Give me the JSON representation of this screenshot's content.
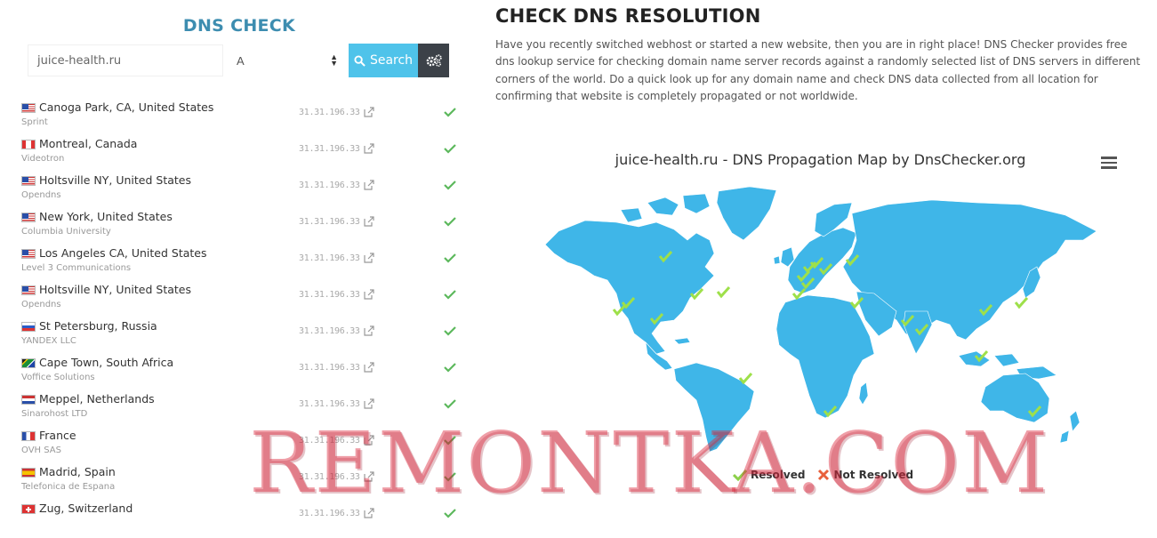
{
  "left": {
    "title": "DNS CHECK",
    "domain_value": "juice-health.ru",
    "record_type": "A",
    "search_label": "Search"
  },
  "results": [
    {
      "location": "Canoga Park, CA, United States",
      "isp": "Sprint",
      "ip": "31.31.196.33",
      "flag": "us"
    },
    {
      "location": "Montreal, Canada",
      "isp": "Videotron",
      "ip": "31.31.196.33",
      "flag": "ca"
    },
    {
      "location": "Holtsville NY, United States",
      "isp": "Opendns",
      "ip": "31.31.196.33",
      "flag": "us"
    },
    {
      "location": "New York, United States",
      "isp": "Columbia University",
      "ip": "31.31.196.33",
      "flag": "us"
    },
    {
      "location": "Los Angeles CA, United States",
      "isp": "Level 3 Communications",
      "ip": "31.31.196.33",
      "flag": "us"
    },
    {
      "location": "Holtsville NY, United States",
      "isp": "Opendns",
      "ip": "31.31.196.33",
      "flag": "us"
    },
    {
      "location": "St Petersburg, Russia",
      "isp": "YANDEX LLC",
      "ip": "31.31.196.33",
      "flag": "ru"
    },
    {
      "location": "Cape Town, South Africa",
      "isp": "Voffice Solutions",
      "ip": "31.31.196.33",
      "flag": "za"
    },
    {
      "location": "Meppel, Netherlands",
      "isp": "Sinarohost LTD",
      "ip": "31.31.196.33",
      "flag": "nl"
    },
    {
      "location": "France",
      "isp": "OVH SAS",
      "ip": "31.31.196.33",
      "flag": "fr"
    },
    {
      "location": "Madrid, Spain",
      "isp": "Telefonica de Espana",
      "ip": "31.31.196.33",
      "flag": "es"
    },
    {
      "location": "Zug, Switzerland",
      "isp": "",
      "ip": "31.31.196.33",
      "flag": "ch"
    }
  ],
  "right": {
    "title": "CHECK DNS RESOLUTION",
    "description": "Have you recently switched webhost or started a new website, then you are in right place! DNS Checker provides free dns lookup service for checking domain name server records against a randomly selected list of DNS servers in different corners of the world. Do a quick look up for any domain name and check DNS data collected from all location for confirming that website is completely propagated or not worldwide.",
    "map_title": "juice-health.ru - DNS Propagation Map by DnsChecker.org",
    "legend_resolved": "Resolved",
    "legend_not_resolved": "Not Resolved"
  },
  "watermark": "REMONTKA.COM",
  "colors": {
    "title_blue": "#3d8db0",
    "search_button": "#4fc3ea",
    "settings_button": "#3c4148",
    "map_land": "#3fb6e8",
    "check_green": "#5cb85c",
    "marker_green": "#9ee04a"
  }
}
